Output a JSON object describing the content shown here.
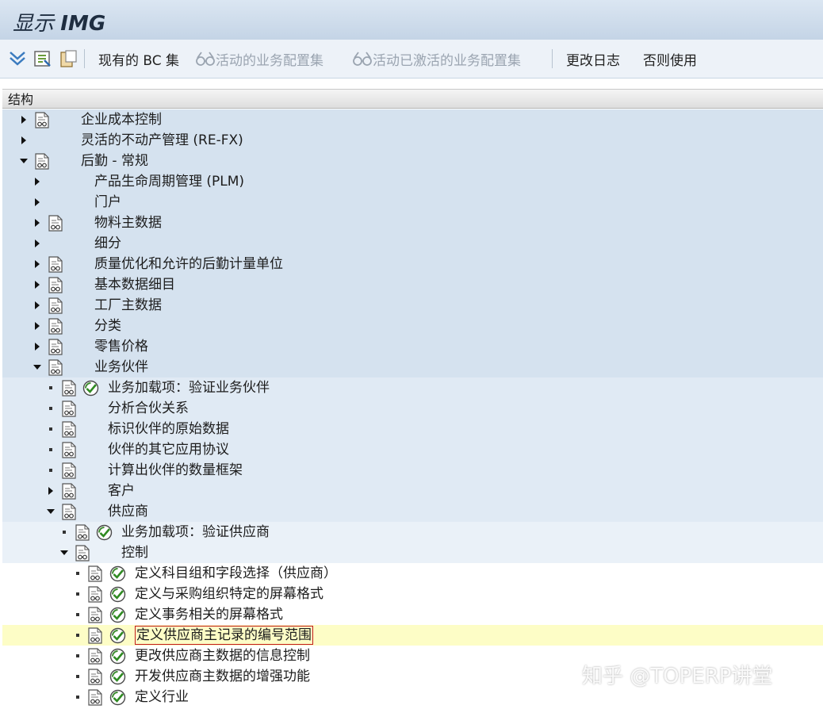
{
  "window": {
    "title_prefix": "显示",
    "title_suffix": "IMG"
  },
  "toolbar": {
    "bc_sets": "现有的 BC 集",
    "active_config_sets": "活动的业务配置集",
    "activated_config_sets": "活动已激活的业务配置集",
    "change_log": "更改日志",
    "where_used": "否则使用"
  },
  "tree": {
    "header": "结构",
    "nodes": [
      {
        "label": "企业成本控制"
      },
      {
        "label": "灵活的不动产管理 (RE-FX)"
      },
      {
        "label": "后勤 - 常规"
      },
      {
        "label": "产品生命周期管理 (PLM)"
      },
      {
        "label": "门户"
      },
      {
        "label": "物料主数据"
      },
      {
        "label": "细分"
      },
      {
        "label": "质量优化和允许的后勤计量单位"
      },
      {
        "label": "基本数据细目"
      },
      {
        "label": "工厂主数据"
      },
      {
        "label": "分类"
      },
      {
        "label": "零售价格"
      },
      {
        "label": "业务伙伴"
      },
      {
        "label": "业务加载项：验证业务伙伴"
      },
      {
        "label": "分析合伙关系"
      },
      {
        "label": "标识伙伴的原始数据"
      },
      {
        "label": "伙伴的其它应用协议"
      },
      {
        "label": "计算出伙伴的数量框架"
      },
      {
        "label": "客户"
      },
      {
        "label": "供应商"
      },
      {
        "label": "业务加载项：验证供应商"
      },
      {
        "label": "控制"
      },
      {
        "label": "定义科目组和字段选择（供应商）"
      },
      {
        "label": "定义与采购组织特定的屏幕格式"
      },
      {
        "label": "定义事务相关的屏幕格式"
      },
      {
        "label": "定义供应商主记录的编号范围"
      },
      {
        "label": "更改供应商主数据的信息控制"
      },
      {
        "label": "开发供应商主数据的增强功能"
      },
      {
        "label": "定义行业"
      }
    ]
  },
  "watermark": "知乎 @TOPERP讲堂",
  "colors": {
    "level1_bg": "#d5e2ef",
    "level2_bg": "#e0eaf4",
    "level3_bg": "#eaf1f8",
    "selected_bg": "#fdfdc6",
    "selection_border": "#c21a1a"
  }
}
